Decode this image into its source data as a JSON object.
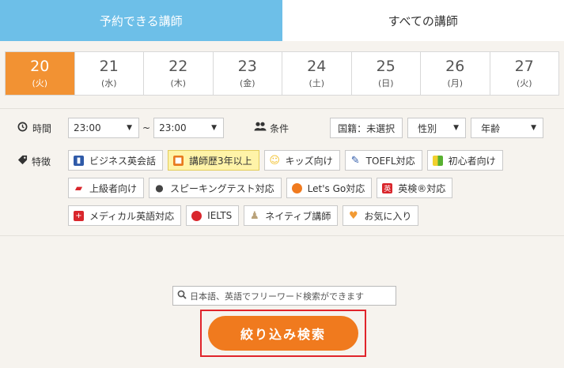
{
  "tabs": [
    {
      "label": "予約できる講師",
      "active": true
    },
    {
      "label": "すべての講師",
      "active": false
    }
  ],
  "dates": [
    {
      "day": "20",
      "dow": "(火)",
      "active": true
    },
    {
      "day": "21",
      "dow": "(水)",
      "active": false
    },
    {
      "day": "22",
      "dow": "(木)",
      "active": false
    },
    {
      "day": "23",
      "dow": "(金)",
      "active": false
    },
    {
      "day": "24",
      "dow": "(土)",
      "active": false
    },
    {
      "day": "25",
      "dow": "(日)",
      "active": false
    },
    {
      "day": "26",
      "dow": "(月)",
      "active": false
    },
    {
      "day": "27",
      "dow": "(火)",
      "active": false
    }
  ],
  "time": {
    "label": "時間",
    "from": "23:00",
    "separator": "~",
    "to": "23:00"
  },
  "conditions": {
    "label": "条件",
    "nationality": "国籍：未選択",
    "gender": "性別",
    "age": "年齢"
  },
  "features": {
    "label": "特徴",
    "items": [
      {
        "label": "ビジネス英会話",
        "icon": "books-icon",
        "icon_color": "#2f5aa8",
        "active": false
      },
      {
        "label": "講師歴3年以上",
        "icon": "cube-icon",
        "icon_color": "#e87a1e",
        "active": true
      },
      {
        "label": "キッズ向け",
        "icon": "smile-icon",
        "icon_color": "#f2c12e",
        "active": false
      },
      {
        "label": "TOEFL対応",
        "icon": "edit-icon",
        "icon_color": "#2f5aa8",
        "active": false
      },
      {
        "label": "初心者向け",
        "icon": "beginner-leaf-icon",
        "icon_color": "#58b031",
        "active": false
      },
      {
        "label": "上級者向け",
        "icon": "graduation-cap-icon",
        "icon_color": "#d9262c",
        "active": false
      },
      {
        "label": "スピーキングテスト対応",
        "icon": "microphone-icon",
        "icon_color": "#444444",
        "active": false
      },
      {
        "label": "Let's Go対応",
        "icon": "ball-icon",
        "icon_color": "#f07a1e",
        "active": false
      },
      {
        "label": "英検®対応",
        "icon": "eiken-icon",
        "icon_color": "#d9262c",
        "active": false
      },
      {
        "label": "メディカル英語対応",
        "icon": "medical-bag-icon",
        "icon_color": "#d9262c",
        "active": false
      },
      {
        "label": "IELTS",
        "icon": "ielts-icon",
        "icon_color": "#d9262c",
        "active": false
      },
      {
        "label": "ネイティブ講師",
        "icon": "person-icon",
        "icon_color": "#b9a27a",
        "active": false
      },
      {
        "label": "お気に入り",
        "icon": "heart-icon",
        "icon_color": "#f29a33",
        "active": false
      }
    ]
  },
  "search": {
    "placeholder": "日本語、英語でフリーワード検索ができます"
  },
  "submit_label": "絞り込み検索",
  "colors": {
    "tab_active": "#6dbfe8",
    "date_active": "#f29233",
    "button": "#f07a1e",
    "highlight_outline": "#e0242b"
  }
}
